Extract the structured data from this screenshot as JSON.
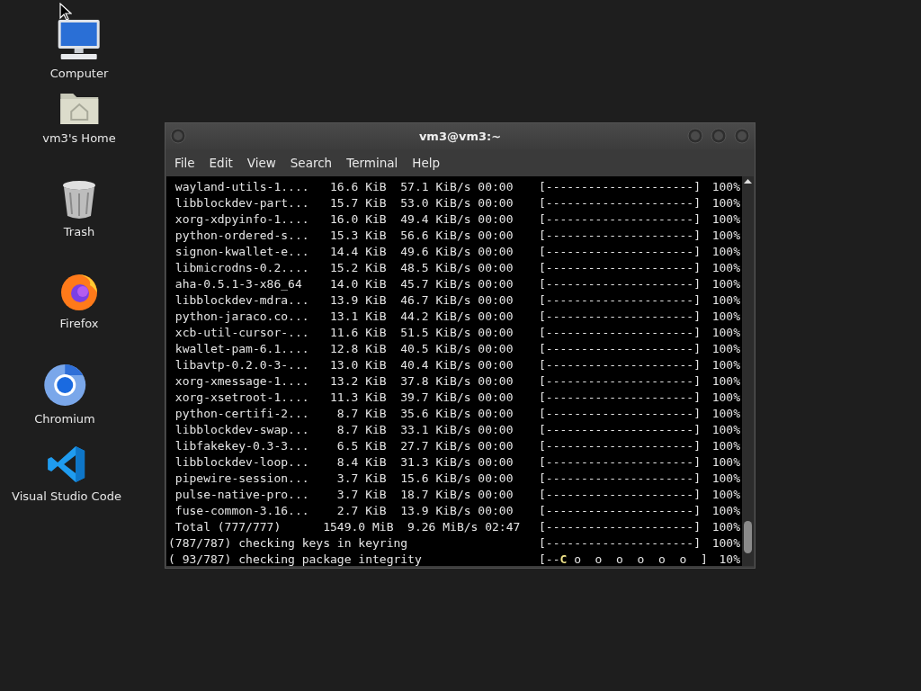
{
  "desktop_icons": [
    {
      "kind": "computer",
      "label": "Computer"
    },
    {
      "kind": "home",
      "label": "vm3's Home"
    },
    {
      "kind": "trash",
      "label": "Trash"
    },
    {
      "kind": "firefox",
      "label": "Firefox"
    },
    {
      "kind": "chromium",
      "label": "Chromium"
    },
    {
      "kind": "vscode",
      "label": "Visual Studio Code"
    }
  ],
  "window": {
    "title": "vm3@vm3:~",
    "menu": [
      "File",
      "Edit",
      "View",
      "Search",
      "Terminal",
      "Help"
    ],
    "lines": [
      {
        "text": " wayland-utils-1....   16.6 KiB  57.1 KiB/s 00:00",
        "bar": "[---------------------]",
        "percent": "100%"
      },
      {
        "text": " libblockdev-part...   15.7 KiB  53.0 KiB/s 00:00",
        "bar": "[---------------------]",
        "percent": "100%"
      },
      {
        "text": " xorg-xdpyinfo-1....   16.0 KiB  49.4 KiB/s 00:00",
        "bar": "[---------------------]",
        "percent": "100%"
      },
      {
        "text": " python-ordered-s...   15.3 KiB  56.6 KiB/s 00:00",
        "bar": "[---------------------]",
        "percent": "100%"
      },
      {
        "text": " signon-kwallet-e...   14.4 KiB  49.6 KiB/s 00:00",
        "bar": "[---------------------]",
        "percent": "100%"
      },
      {
        "text": " libmicrodns-0.2....   15.2 KiB  48.5 KiB/s 00:00",
        "bar": "[---------------------]",
        "percent": "100%"
      },
      {
        "text": " aha-0.5.1-3-x86_64    14.0 KiB  45.7 KiB/s 00:00",
        "bar": "[---------------------]",
        "percent": "100%"
      },
      {
        "text": " libblockdev-mdra...   13.9 KiB  46.7 KiB/s 00:00",
        "bar": "[---------------------]",
        "percent": "100%"
      },
      {
        "text": " python-jaraco.co...   13.1 KiB  44.2 KiB/s 00:00",
        "bar": "[---------------------]",
        "percent": "100%"
      },
      {
        "text": " xcb-util-cursor-...   11.6 KiB  51.5 KiB/s 00:00",
        "bar": "[---------------------]",
        "percent": "100%"
      },
      {
        "text": " kwallet-pam-6.1....   12.8 KiB  40.5 KiB/s 00:00",
        "bar": "[---------------------]",
        "percent": "100%"
      },
      {
        "text": " libavtp-0.2.0-3-...   13.0 KiB  40.4 KiB/s 00:00",
        "bar": "[---------------------]",
        "percent": "100%"
      },
      {
        "text": " xorg-xmessage-1....   13.2 KiB  37.8 KiB/s 00:00",
        "bar": "[---------------------]",
        "percent": "100%"
      },
      {
        "text": " xorg-xsetroot-1....   11.3 KiB  39.7 KiB/s 00:00",
        "bar": "[---------------------]",
        "percent": "100%"
      },
      {
        "text": " python-certifi-2...    8.7 KiB  35.6 KiB/s 00:00",
        "bar": "[---------------------]",
        "percent": "100%"
      },
      {
        "text": " libblockdev-swap...    8.7 KiB  33.1 KiB/s 00:00",
        "bar": "[---------------------]",
        "percent": "100%"
      },
      {
        "text": " libfakekey-0.3-3...    6.5 KiB  27.7 KiB/s 00:00",
        "bar": "[---------------------]",
        "percent": "100%"
      },
      {
        "text": " libblockdev-loop...    8.4 KiB  31.3 KiB/s 00:00",
        "bar": "[---------------------]",
        "percent": "100%"
      },
      {
        "text": " pipewire-session...    3.7 KiB  15.6 KiB/s 00:00",
        "bar": "[---------------------]",
        "percent": "100%"
      },
      {
        "text": " pulse-native-pro...    3.7 KiB  18.7 KiB/s 00:00",
        "bar": "[---------------------]",
        "percent": "100%"
      },
      {
        "text": " fuse-common-3.16...    2.7 KiB  13.9 KiB/s 00:00",
        "bar": "[---------------------]",
        "percent": "100%"
      },
      {
        "text": " Total (777/777)      1549.0 MiB  9.26 MiB/s 02:47",
        "bar": "[---------------------]",
        "percent": "100%"
      },
      {
        "text": "(787/787) checking keys in keyring",
        "bar": "[---------------------]",
        "percent": "100%"
      },
      {
        "text": "( 93/787) checking package integrity",
        "bar": "[--",
        "pacman": "C",
        "bar_rest": " o  o  o  o  o  o  ]",
        "percent": "10%"
      }
    ]
  }
}
